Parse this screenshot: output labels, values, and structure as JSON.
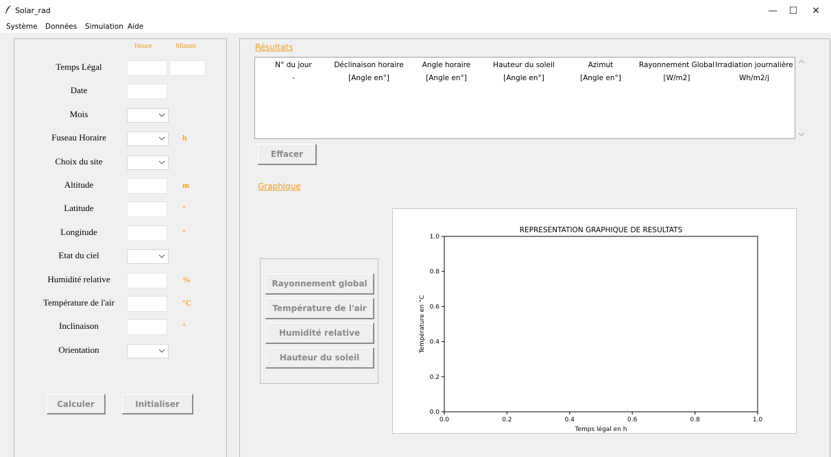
{
  "window": {
    "title": "Solar_rad",
    "minimize": "—",
    "maximize": "☐",
    "close": "✕"
  },
  "menu": [
    "Système",
    "Données",
    "Simulation",
    "Aide"
  ],
  "form": {
    "col_headers": {
      "heure": "Heure",
      "minute": "Minute"
    },
    "fields": [
      {
        "label": "Temps Légal",
        "type": "entry2",
        "unit": ""
      },
      {
        "label": "Date",
        "type": "entry",
        "unit": ""
      },
      {
        "label": "Mois",
        "type": "combo",
        "unit": ""
      },
      {
        "label": "Fuseau Horaire",
        "type": "combo",
        "unit": "h"
      },
      {
        "label": "Choix du site",
        "type": "combo",
        "unit": ""
      },
      {
        "label": "Altitude",
        "type": "entry",
        "unit": "m"
      },
      {
        "label": "Latitude",
        "type": "entry",
        "unit": "°"
      },
      {
        "label": "Longitude",
        "type": "entry",
        "unit": "°"
      },
      {
        "label": "Etat du ciel",
        "type": "combo",
        "unit": ""
      },
      {
        "label": "Humidité relative",
        "type": "entry",
        "unit": "%"
      },
      {
        "label": "Température de l'air",
        "type": "entry",
        "unit": "°C"
      },
      {
        "label": "Inclinaison",
        "type": "entry",
        "unit": "°"
      },
      {
        "label": "Orientation",
        "type": "combo",
        "unit": ""
      }
    ],
    "calc_button": "Calculer",
    "init_button": "Initialiser"
  },
  "results": {
    "title": "Résultats",
    "columns": [
      "N° du jour",
      "Déclinaison horaire",
      "Angle horaire",
      "Hauteur du soleil",
      "Azimut",
      "Rayonnement Global",
      "Irradiation journalière"
    ],
    "units": [
      "-",
      "[Angle en°]",
      "[Angle en°]",
      "[Angle en°]",
      "[Angle en°]",
      "[W/m2]",
      "Wh/m2/j"
    ],
    "clear_button": "Effacer"
  },
  "graph": {
    "title": "Graphique",
    "buttons": [
      "Rayonnement global",
      "Température de l'air",
      "Humidité relative",
      "Hauteur du soleil"
    ]
  },
  "chart_data": {
    "type": "line",
    "title": "REPRESENTATION GRAPHIQUE DE RESULTATS",
    "xlabel": "Temps légal en h",
    "ylabel": "Température en °C",
    "xlim": [
      0.0,
      1.0
    ],
    "ylim": [
      0.0,
      1.0
    ],
    "xticks": [
      "0.0",
      "0.2",
      "0.4",
      "0.6",
      "0.8",
      "1.0"
    ],
    "yticks": [
      "0.0",
      "0.2",
      "0.4",
      "0.6",
      "0.8",
      "1.0"
    ],
    "series": []
  }
}
